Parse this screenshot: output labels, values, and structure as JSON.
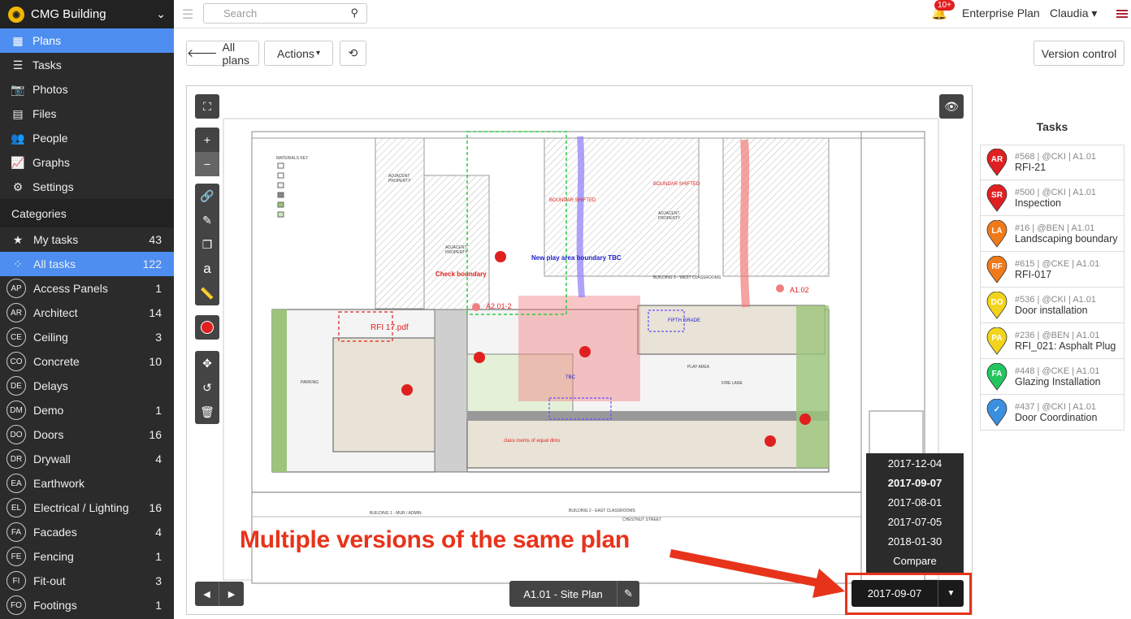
{
  "brand": {
    "name": "CMG Building"
  },
  "nav": [
    {
      "label": "Plans",
      "icon": "map-icon",
      "active": true
    },
    {
      "label": "Tasks",
      "icon": "list-icon"
    },
    {
      "label": "Photos",
      "icon": "camera-icon"
    },
    {
      "label": "Files",
      "icon": "file-icon"
    },
    {
      "label": "People",
      "icon": "users-icon"
    },
    {
      "label": "Graphs",
      "icon": "chart-icon"
    },
    {
      "label": "Settings",
      "icon": "gear-icon"
    }
  ],
  "categories": {
    "title": "Categories",
    "special": [
      {
        "label": "My tasks",
        "count": "43",
        "icon": "star-icon"
      },
      {
        "label": "All tasks",
        "count": "122",
        "icon": "grid-icon",
        "active": true
      }
    ],
    "items": [
      {
        "abbr": "AP",
        "label": "Access Panels",
        "count": "1"
      },
      {
        "abbr": "AR",
        "label": "Architect",
        "count": "14"
      },
      {
        "abbr": "CE",
        "label": "Ceiling",
        "count": "3"
      },
      {
        "abbr": "CO",
        "label": "Concrete",
        "count": "10"
      },
      {
        "abbr": "DE",
        "label": "Delays",
        "count": ""
      },
      {
        "abbr": "DM",
        "label": "Demo",
        "count": "1"
      },
      {
        "abbr": "DO",
        "label": "Doors",
        "count": "16"
      },
      {
        "abbr": "DR",
        "label": "Drywall",
        "count": "4"
      },
      {
        "abbr": "EA",
        "label": "Earthwork",
        "count": ""
      },
      {
        "abbr": "EL",
        "label": "Electrical / Lighting",
        "count": "16"
      },
      {
        "abbr": "FA",
        "label": "Facades",
        "count": "4"
      },
      {
        "abbr": "FE",
        "label": "Fencing",
        "count": "1"
      },
      {
        "abbr": "FI",
        "label": "Fit-out",
        "count": "3"
      },
      {
        "abbr": "FO",
        "label": "Footings",
        "count": "1"
      }
    ]
  },
  "topbar": {
    "search_placeholder": "Search",
    "notifications": "10+",
    "plan": "Enterprise Plan",
    "user": "Claudia"
  },
  "toolbar": {
    "all_plans": "All plans",
    "actions": "Actions",
    "version_control": "Version control"
  },
  "tasks": {
    "title": "Tasks",
    "items": [
      {
        "abbr": "AR",
        "meta": "#568 | @CKI | A1.01",
        "name": "RFI-21",
        "color": "#e02020"
      },
      {
        "abbr": "SR",
        "meta": "#500 | @CKI | A1.01",
        "name": "Inspection",
        "color": "#e02020"
      },
      {
        "abbr": "LA",
        "meta": "#16 | @BEN | A1.01",
        "name": "Landscaping boundary",
        "color": "#f07a1a"
      },
      {
        "abbr": "RF",
        "meta": "#615 | @CKE | A1.01",
        "name": "RFI-017",
        "color": "#f07a1a"
      },
      {
        "abbr": "DO",
        "meta": "#536 | @CKI | A1.01",
        "name": "Door installation",
        "color": "#f2d41c"
      },
      {
        "abbr": "PA",
        "meta": "#236 | @BEN | A1.01",
        "name": "RFI_021: Asphalt Plug",
        "color": "#f2d41c"
      },
      {
        "abbr": "FA",
        "meta": "#448 | @CKE | A1.01",
        "name": "Glazing Installation",
        "color": "#22c55e"
      },
      {
        "abbr": "✓",
        "meta": "#437 | @CKI | A1.01",
        "name": "Door Coordination",
        "color": "#3b8fe0"
      }
    ]
  },
  "plan": {
    "label": "A1.01 - Site Plan",
    "annotations": {
      "rfi": "RFI 17.pdf",
      "play": "New play area boundary TBC",
      "check": "Check boundary",
      "a201": "A2.01-2",
      "a102": "A1.02",
      "boundary1": "BOUNDAR SHIFTED",
      "boundary2": "BOUNDAR SHIFTED",
      "classrooms": "class rooms of equal dims",
      "tbc": "TBC",
      "fifth": "FIFTH GRADE"
    }
  },
  "versions": {
    "current": "2017-09-07",
    "options": [
      "2017-12-04",
      "2017-09-07",
      "2017-08-01",
      "2017-07-05",
      "2018-01-30",
      "Compare"
    ]
  },
  "callout": "Multiple versions of the same plan"
}
